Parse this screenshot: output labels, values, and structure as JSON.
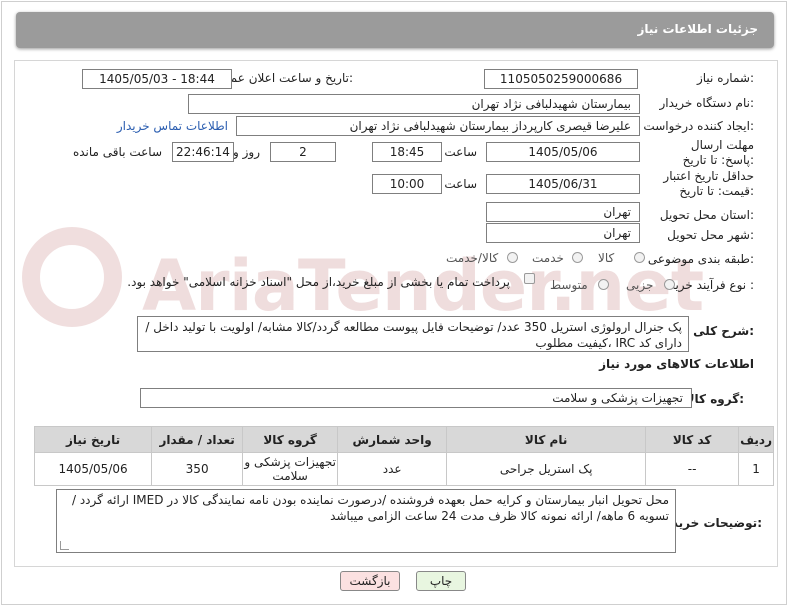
{
  "header": {
    "title": "جزئیات اطلاعات نیاز"
  },
  "fields": {
    "need_number_label": "شماره نیاز:",
    "need_number": "1105050259000686",
    "announce_label": "تاریخ و ساعت اعلان عمومی:",
    "announce_value": "1405/05/03 - 18:44",
    "buyer_org_label": "نام دستگاه خریدار:",
    "buyer_org": "بیمارستان شهیدلبافی نژاد تهران",
    "requester_label": "ایجاد کننده درخواست:",
    "requester": "علیرضا قیصری کارپرداز بیمارستان شهیدلبافی نژاد تهران",
    "contact_link": "اطلاعات تماس خریدار",
    "reply_deadline_label": "مهلت ارسال پاسخ: تا تاریخ:",
    "reply_date": "1405/05/06",
    "time_label": "ساعت",
    "reply_time": "18:45",
    "days_value": "2",
    "days_label": "روز و",
    "remaining_time": "22:46:14",
    "remaining_label": "ساعت باقی مانده",
    "price_validity_label": "حداقل تاریخ اعتبار قیمت: تا تاریخ:",
    "price_date": "1405/06/31",
    "price_time": "10:00",
    "delivery_province_label": "استان محل تحویل:",
    "delivery_province": "تهران",
    "delivery_city_label": "شهر محل تحویل:",
    "delivery_city": "تهران",
    "category_label": "طبقه بندی موضوعی:",
    "category_options": [
      "کالا",
      "خدمت",
      "کالا/خدمت"
    ],
    "process_label": "نوع فرآیند خرید :",
    "process_options": [
      "جزیی",
      "متوسط"
    ],
    "payment_note": "پرداخت تمام یا بخشی از مبلغ خرید،از محل \"اسناد خزانه اسلامی\" خواهد بود.",
    "description_label": "شرح کلی نیاز:",
    "description": "پک جنرال ارولوژی استریل   350 عدد/  توضیحات فایل پیوست مطالعه گردد/کالا مشابه/ اولویت با تولید داخل / دارای کد IRC ،کیفیت مطلوب",
    "goods_info_title": "اطلاعات کالاهای مورد نیاز",
    "goods_group_label": "گروه کالا:",
    "goods_group": "تجهیزات پزشکی و سلامت",
    "buyer_notes_label": "توضیحات خریدار:",
    "buyer_notes": "محل تحویل انبار بیمارستان و کرایه حمل بعهده فروشنده /درصورت نماینده بودن نامه نمایندگی کالا در  IMED ارائه گردد / تسویه 6 ماهه/ ارائه نمونه کالا ظرف مدت  24 ساعت الزامی میباشد"
  },
  "table": {
    "headers": [
      "ردیف",
      "کد کالا",
      "نام کالا",
      "واحد شمارش",
      "گروه کالا",
      "تعداد / مقدار",
      "تاریخ نیاز"
    ],
    "rows": [
      [
        "1",
        "--",
        "پک استریل جراحی",
        "عدد",
        "تجهیزات پزشکی و سلامت",
        "350",
        "1405/05/06"
      ]
    ]
  },
  "buttons": {
    "print": "چاپ",
    "back": "بازگشت"
  },
  "watermark": "AriaTender.net",
  "colors": {
    "header_bg": "#9b9b9b",
    "link": "#2a5db0",
    "print_btn": "#e8f6e0",
    "back_btn": "#fbe1e1",
    "watermark": "#8a0000"
  }
}
